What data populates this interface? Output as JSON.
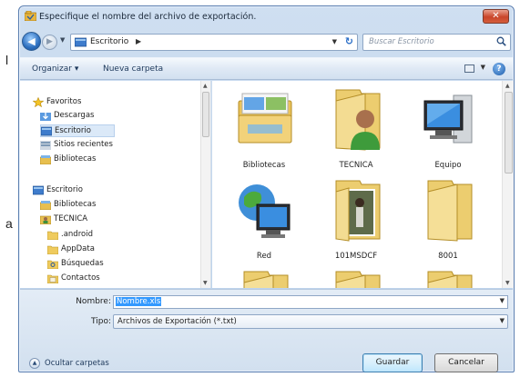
{
  "background": {
    "char_top": "l",
    "char_bottom": "a"
  },
  "window": {
    "title": "Especifique el nombre del archivo de exportación.",
    "close_glyph": "✕"
  },
  "nav": {
    "back_glyph": "◀",
    "forward_glyph": "▶",
    "address_path": "Escritorio",
    "address_sep": "▶",
    "search_placeholder": "Buscar Escritorio"
  },
  "toolbar": {
    "organize": "Organizar ▾",
    "new_folder": "Nueva carpeta",
    "help": "?"
  },
  "tree": [
    {
      "label": "Favoritos",
      "icon": "star-icon",
      "indent": 0
    },
    {
      "label": "Descargas",
      "icon": "downloads-icon",
      "indent": 1
    },
    {
      "label": "Escritorio",
      "icon": "desktop-icon",
      "indent": 1,
      "selected": true
    },
    {
      "label": "Sitios recientes",
      "icon": "recent-places-icon",
      "indent": 1
    },
    {
      "label": "Bibliotecas",
      "icon": "libraries-icon",
      "indent": 1
    },
    {
      "label": "Escritorio",
      "icon": "desktop-icon",
      "indent": 0
    },
    {
      "label": "Bibliotecas",
      "icon": "libraries-icon",
      "indent": 1
    },
    {
      "label": "TECNICA",
      "icon": "user-folder-icon",
      "indent": 1
    },
    {
      "label": ".android",
      "icon": "folder-icon",
      "indent": 2
    },
    {
      "label": "AppData",
      "icon": "folder-icon",
      "indent": 2
    },
    {
      "label": "Búsquedas",
      "icon": "searches-folder-icon",
      "indent": 2
    },
    {
      "label": "Contactos",
      "icon": "contacts-folder-icon",
      "indent": 2
    }
  ],
  "files": [
    {
      "label": "Bibliotecas",
      "icon": "libraries-folder-icon"
    },
    {
      "label": "TECNICA",
      "icon": "user-folder-icon"
    },
    {
      "label": "Equipo",
      "icon": "computer-icon"
    },
    {
      "label": "Red",
      "icon": "network-icon"
    },
    {
      "label": "101MSDCF",
      "icon": "photo-folder-icon"
    },
    {
      "label": "8001",
      "icon": "folder-icon"
    },
    {
      "label": "",
      "icon": "folder-icon"
    },
    {
      "label": "",
      "icon": "folder-icon"
    },
    {
      "label": "",
      "icon": "folder-icon"
    }
  ],
  "form": {
    "name_label": "Nombre:",
    "name_value": "Nombre.xls",
    "type_label": "Tipo:",
    "type_value": "Archivos de Exportación (*.txt)"
  },
  "footer": {
    "hide_folders": "Ocultar carpetas",
    "save": "Guardar",
    "cancel": "Cancelar"
  }
}
